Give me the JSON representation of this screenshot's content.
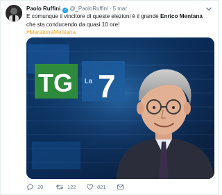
{
  "tweet": {
    "author_name": "Paolo Ruffini",
    "handle": "@_PaoloRuffini",
    "separator": "·",
    "time": "5 mar",
    "text_before": "E comunque il vincitore di queste elezioni è il grande ",
    "text_bold": "Enrico Mentana",
    "text_after": " che sta conducendo da quasi 10 ore!",
    "hashtag": "#MaratonaMentana"
  },
  "media": {
    "logo_text": "TG",
    "logo_sub": "La",
    "logo_number": "7"
  },
  "actions": {
    "reply_count": "20",
    "retweet_count": "122",
    "like_count": "821"
  },
  "icons": {
    "verified": "verified-badge-icon",
    "menu": "chevron-down-icon",
    "reply": "reply-icon",
    "retweet": "retweet-icon",
    "like": "heart-icon",
    "dm": "envelope-icon"
  },
  "colors": {
    "hashtag": "#f5a623",
    "verified": "#1da1f2",
    "secondary_text": "#657786"
  }
}
